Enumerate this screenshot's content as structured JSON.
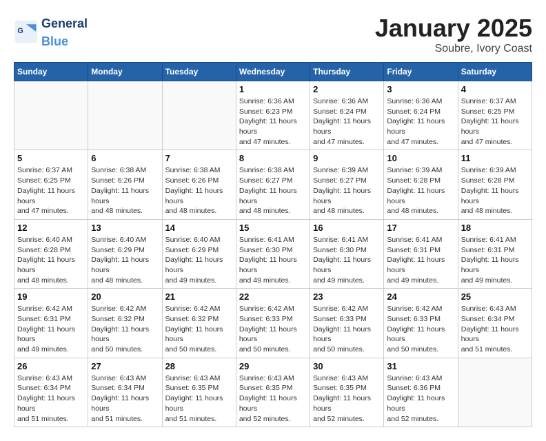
{
  "header": {
    "logo_general": "General",
    "logo_blue": "Blue",
    "month": "January 2025",
    "location": "Soubre, Ivory Coast"
  },
  "days_of_week": [
    "Sunday",
    "Monday",
    "Tuesday",
    "Wednesday",
    "Thursday",
    "Friday",
    "Saturday"
  ],
  "weeks": [
    [
      {
        "day": "",
        "info": ""
      },
      {
        "day": "",
        "info": ""
      },
      {
        "day": "",
        "info": ""
      },
      {
        "day": "1",
        "info": "Sunrise: 6:36 AM\nSunset: 6:23 PM\nDaylight: 11 hours and 47 minutes."
      },
      {
        "day": "2",
        "info": "Sunrise: 6:36 AM\nSunset: 6:24 PM\nDaylight: 11 hours and 47 minutes."
      },
      {
        "day": "3",
        "info": "Sunrise: 6:36 AM\nSunset: 6:24 PM\nDaylight: 11 hours and 47 minutes."
      },
      {
        "day": "4",
        "info": "Sunrise: 6:37 AM\nSunset: 6:25 PM\nDaylight: 11 hours and 47 minutes."
      }
    ],
    [
      {
        "day": "5",
        "info": "Sunrise: 6:37 AM\nSunset: 6:25 PM\nDaylight: 11 hours and 47 minutes."
      },
      {
        "day": "6",
        "info": "Sunrise: 6:38 AM\nSunset: 6:26 PM\nDaylight: 11 hours and 48 minutes."
      },
      {
        "day": "7",
        "info": "Sunrise: 6:38 AM\nSunset: 6:26 PM\nDaylight: 11 hours and 48 minutes."
      },
      {
        "day": "8",
        "info": "Sunrise: 6:38 AM\nSunset: 6:27 PM\nDaylight: 11 hours and 48 minutes."
      },
      {
        "day": "9",
        "info": "Sunrise: 6:39 AM\nSunset: 6:27 PM\nDaylight: 11 hours and 48 minutes."
      },
      {
        "day": "10",
        "info": "Sunrise: 6:39 AM\nSunset: 6:28 PM\nDaylight: 11 hours and 48 minutes."
      },
      {
        "day": "11",
        "info": "Sunrise: 6:39 AM\nSunset: 6:28 PM\nDaylight: 11 hours and 48 minutes."
      }
    ],
    [
      {
        "day": "12",
        "info": "Sunrise: 6:40 AM\nSunset: 6:28 PM\nDaylight: 11 hours and 48 minutes."
      },
      {
        "day": "13",
        "info": "Sunrise: 6:40 AM\nSunset: 6:29 PM\nDaylight: 11 hours and 48 minutes."
      },
      {
        "day": "14",
        "info": "Sunrise: 6:40 AM\nSunset: 6:29 PM\nDaylight: 11 hours and 49 minutes."
      },
      {
        "day": "15",
        "info": "Sunrise: 6:41 AM\nSunset: 6:30 PM\nDaylight: 11 hours and 49 minutes."
      },
      {
        "day": "16",
        "info": "Sunrise: 6:41 AM\nSunset: 6:30 PM\nDaylight: 11 hours and 49 minutes."
      },
      {
        "day": "17",
        "info": "Sunrise: 6:41 AM\nSunset: 6:31 PM\nDaylight: 11 hours and 49 minutes."
      },
      {
        "day": "18",
        "info": "Sunrise: 6:41 AM\nSunset: 6:31 PM\nDaylight: 11 hours and 49 minutes."
      }
    ],
    [
      {
        "day": "19",
        "info": "Sunrise: 6:42 AM\nSunset: 6:31 PM\nDaylight: 11 hours and 49 minutes."
      },
      {
        "day": "20",
        "info": "Sunrise: 6:42 AM\nSunset: 6:32 PM\nDaylight: 11 hours and 50 minutes."
      },
      {
        "day": "21",
        "info": "Sunrise: 6:42 AM\nSunset: 6:32 PM\nDaylight: 11 hours and 50 minutes."
      },
      {
        "day": "22",
        "info": "Sunrise: 6:42 AM\nSunset: 6:33 PM\nDaylight: 11 hours and 50 minutes."
      },
      {
        "day": "23",
        "info": "Sunrise: 6:42 AM\nSunset: 6:33 PM\nDaylight: 11 hours and 50 minutes."
      },
      {
        "day": "24",
        "info": "Sunrise: 6:42 AM\nSunset: 6:33 PM\nDaylight: 11 hours and 50 minutes."
      },
      {
        "day": "25",
        "info": "Sunrise: 6:43 AM\nSunset: 6:34 PM\nDaylight: 11 hours and 51 minutes."
      }
    ],
    [
      {
        "day": "26",
        "info": "Sunrise: 6:43 AM\nSunset: 6:34 PM\nDaylight: 11 hours and 51 minutes."
      },
      {
        "day": "27",
        "info": "Sunrise: 6:43 AM\nSunset: 6:34 PM\nDaylight: 11 hours and 51 minutes."
      },
      {
        "day": "28",
        "info": "Sunrise: 6:43 AM\nSunset: 6:35 PM\nDaylight: 11 hours and 51 minutes."
      },
      {
        "day": "29",
        "info": "Sunrise: 6:43 AM\nSunset: 6:35 PM\nDaylight: 11 hours and 52 minutes."
      },
      {
        "day": "30",
        "info": "Sunrise: 6:43 AM\nSunset: 6:35 PM\nDaylight: 11 hours and 52 minutes."
      },
      {
        "day": "31",
        "info": "Sunrise: 6:43 AM\nSunset: 6:36 PM\nDaylight: 11 hours and 52 minutes."
      },
      {
        "day": "",
        "info": ""
      }
    ]
  ]
}
